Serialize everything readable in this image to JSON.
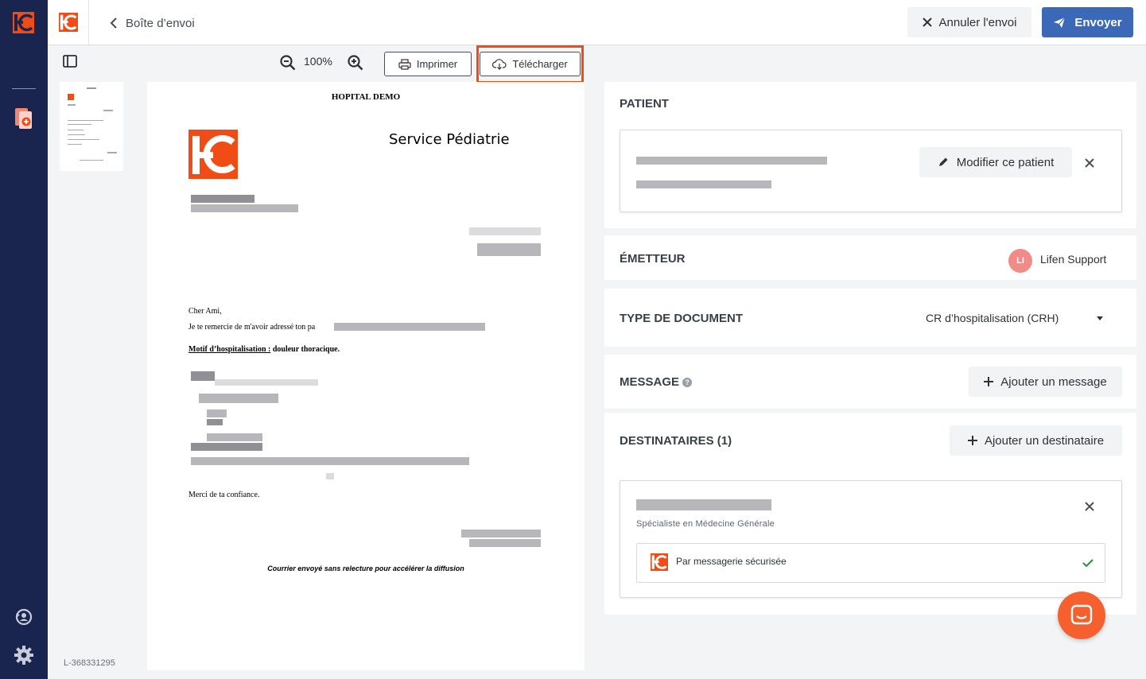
{
  "colors": {
    "rail_bg": "#19254f",
    "brand_orange": "#f04d16",
    "primary_blue": "#3c69b7",
    "avatar_pink": "#f28b87",
    "check_green": "#2e8b3e"
  },
  "icons": {
    "rail": [
      "lifen-logo-icon",
      "document-medical-icon",
      "sync-icon",
      "gear-icon"
    ],
    "toolbar": [
      "sidebar-toggle-icon",
      "zoom-out-icon",
      "zoom-in-icon",
      "printer-icon",
      "cloud-download-icon"
    ]
  },
  "topbar": {
    "back_label": "Boîte d’envoi",
    "cancel_label": "Annuler l'envoi",
    "send_label": "Envoyer"
  },
  "viewer": {
    "zoom": "100%",
    "print_label": "Imprimer",
    "download_label": "Télécharger",
    "document_id": "L-368331295"
  },
  "document": {
    "hospital": "HOPITAL DEMO",
    "service": "Service Pédiatrie",
    "greeting": "Cher Ami,",
    "intro": "Je te remercie de m'avoir adressé ton pa",
    "motif_label": "Motif d’hospitalisation :",
    "motif_value": " douleur thoracique.",
    "closing": "Merci de ta confiance.",
    "footer": "Courrier envoyé sans relecture pour accélérer la diffusion"
  },
  "panel": {
    "patient": {
      "title": "PATIENT",
      "edit_label": "Modifier ce patient"
    },
    "sender": {
      "title": "ÉMETTEUR",
      "initials": "LI",
      "name": "Lifen Support"
    },
    "document_type": {
      "title": "TYPE DE DOCUMENT",
      "selected": "CR d’hospitalisation (CRH)"
    },
    "message": {
      "title": "MESSAGE",
      "help": "?",
      "add_label": "Ajouter un message"
    },
    "recipients": {
      "title": "DESTINATAIRES (1)",
      "add_label": "Ajouter un destinataire",
      "items": [
        {
          "role": "Spécialiste en Médecine Générale",
          "channel": "Par messagerie sécurisée"
        }
      ]
    }
  }
}
